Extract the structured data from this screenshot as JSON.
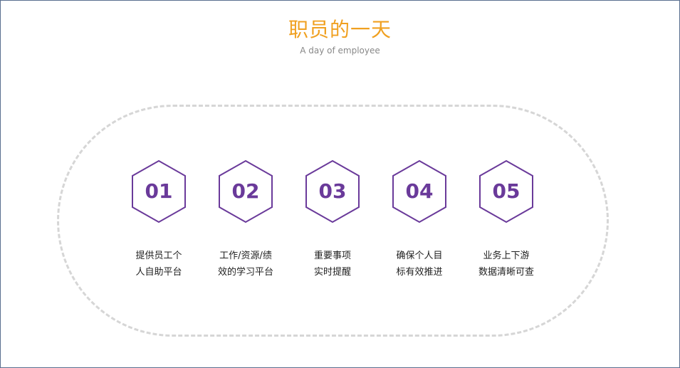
{
  "header": {
    "title": "职员的一天",
    "subtitle": "A day of employee"
  },
  "colors": {
    "title": "#f0a020",
    "accent": "#6a3a9a",
    "dashed_border": "#d6d6d6"
  },
  "steps": [
    {
      "number": "01",
      "line1": "提供员工个",
      "line2": "人自助平台"
    },
    {
      "number": "02",
      "line1": "工作/资源/绩",
      "line2": "效的学习平台"
    },
    {
      "number": "03",
      "line1": "重要事项",
      "line2": "实时提醒"
    },
    {
      "number": "04",
      "line1": "确保个人目",
      "line2": "标有效推进"
    },
    {
      "number": "05",
      "line1": "业务上下游",
      "line2": "数据清晰可查"
    }
  ]
}
